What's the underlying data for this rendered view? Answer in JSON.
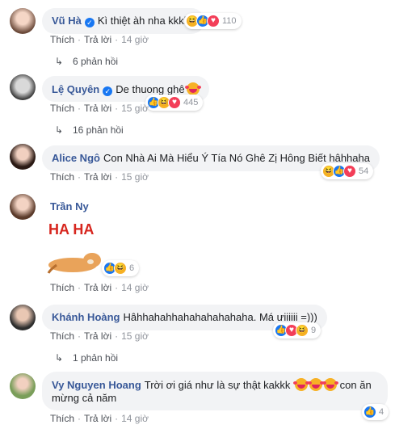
{
  "labels": {
    "like": "Thích",
    "reply": "Trả lời"
  },
  "comments": [
    {
      "name": "Vũ Hà",
      "verified": true,
      "text": "Kì thiệt àh nha kkkkk",
      "reactions": [
        "haha",
        "like",
        "love"
      ],
      "count": "110",
      "time": "14 giờ",
      "replies": "6 phản hồi"
    },
    {
      "name": "Lệ Quyên",
      "verified": true,
      "text": "De thuong ghê",
      "reactions": [
        "like",
        "haha",
        "love"
      ],
      "count": "445",
      "time": "15 giờ",
      "replies": "16 phản hồi"
    },
    {
      "name": "Alice Ngô",
      "verified": false,
      "text": "Con Nhà Ai Mà Hiểu Ý Tía Nó Ghê Zị Hông Biết hâhhaha",
      "reactions": [
        "haha",
        "like",
        "love"
      ],
      "count": "54",
      "time": "15 giờ"
    },
    {
      "name": "Trần Ny",
      "verified": false,
      "sticker_text": "HA HA",
      "reactions": [
        "like",
        "haha"
      ],
      "count": "6",
      "time": "14 giờ"
    },
    {
      "name": "Khánh Hoàng",
      "verified": false,
      "text": "Hâhhahahhahahahahahaha. Má ưiiiiii =)))",
      "reactions": [
        "like",
        "love",
        "haha"
      ],
      "count": "9",
      "time": "15 giờ",
      "replies": "1 phản hồi"
    },
    {
      "name": "Vy Nguyen Hoang",
      "verified": false,
      "text_line1": "Trời ơi giá như là sự thật kakkk",
      "text_line1_end": "con ăn",
      "text_line2": "mừng cả năm",
      "reactions": [
        "like"
      ],
      "count": "4",
      "time": "14 giờ"
    }
  ],
  "colors": {
    "name": "#385898",
    "bubble": "#f2f3f5",
    "like": "#1877f2",
    "love": "#f33e58",
    "haha": "#f7b125",
    "meta": "#90949c"
  }
}
